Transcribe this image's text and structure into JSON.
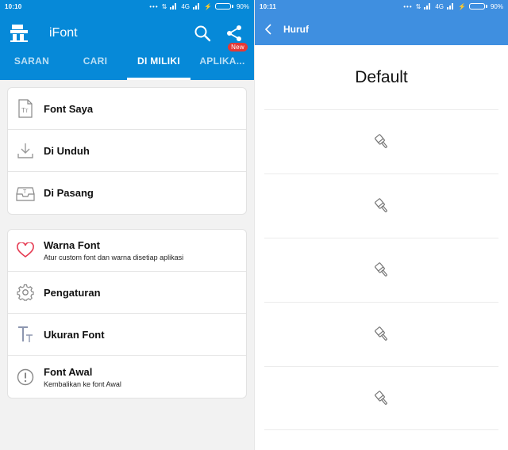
{
  "left": {
    "status": {
      "time": "10:10",
      "network": "4G",
      "battery": "90%",
      "battery_level": 0.9,
      "battery_color": "#58d453"
    },
    "app": {
      "title": "iFont",
      "color": "#0689d8"
    },
    "tabs": [
      {
        "label": "SARAN"
      },
      {
        "label": "CARI"
      },
      {
        "label": "DI MILIKI",
        "active": true
      },
      {
        "label": "APLIKA...",
        "badge": "New"
      }
    ],
    "group1": [
      {
        "label": "Font Saya",
        "icon": "font-file-icon"
      },
      {
        "label": "Di Unduh",
        "icon": "download-icon"
      },
      {
        "label": "Di Pasang",
        "icon": "install-tray-icon"
      }
    ],
    "group2": [
      {
        "label": "Warna Font",
        "sub": "Atur custom font dan warna disetiap aplikasi",
        "icon": "heart-icon"
      },
      {
        "label": "Pengaturan",
        "icon": "gear-icon"
      },
      {
        "label": "Ukuran Font",
        "icon": "text-size-icon"
      },
      {
        "label": "Font Awal",
        "sub": "Kembalikan ke font Awal",
        "icon": "alert-icon"
      }
    ]
  },
  "right": {
    "status": {
      "time": "10:11",
      "network": "4G",
      "battery": "90%",
      "battery_level": 0.9
    },
    "header": {
      "title": "Huruf",
      "color": "#3f8fe0"
    },
    "default_label": "Default",
    "font_items": [
      {
        "icon": "brush-icon"
      },
      {
        "icon": "brush-icon"
      },
      {
        "icon": "brush-icon"
      },
      {
        "icon": "brush-icon"
      },
      {
        "icon": "brush-icon"
      }
    ]
  }
}
